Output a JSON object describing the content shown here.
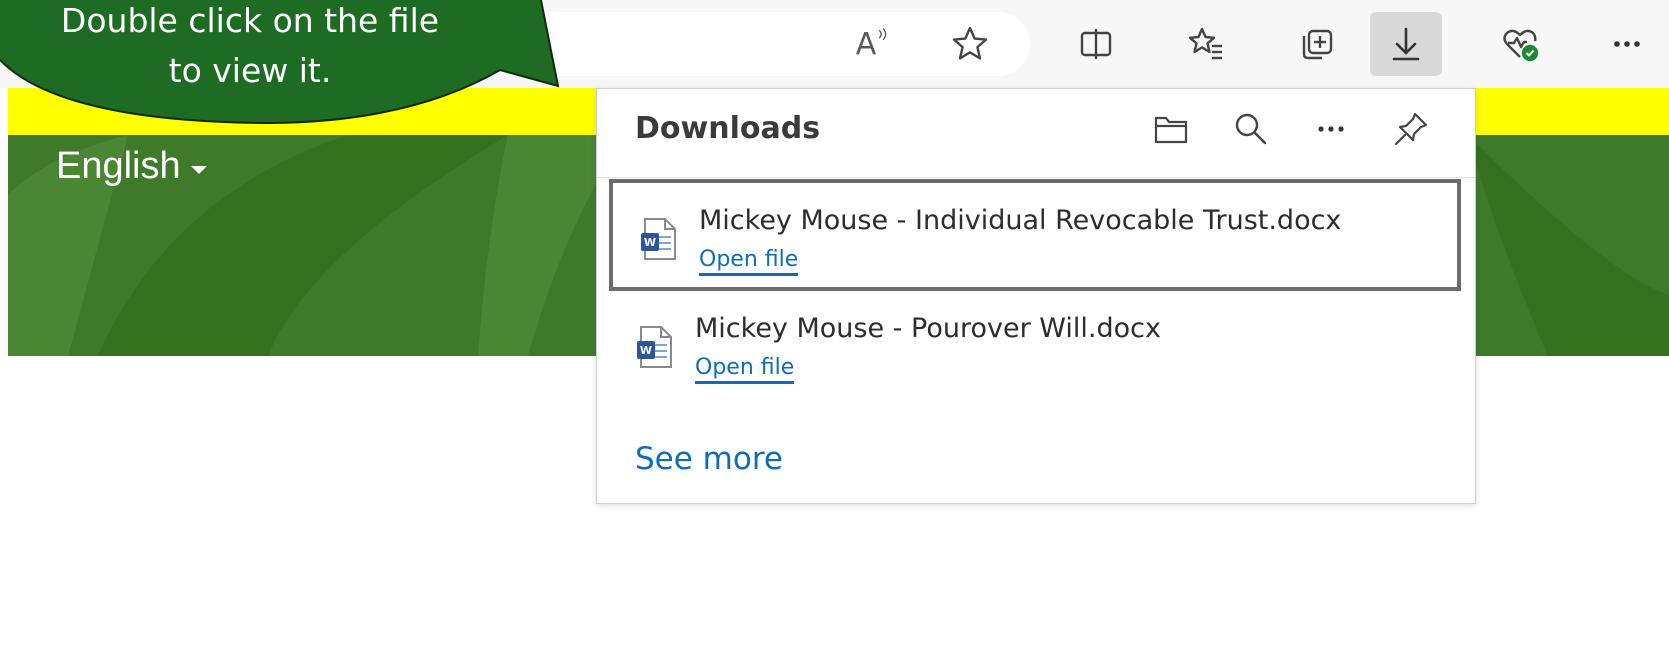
{
  "callout": {
    "line1": "Double click on the file",
    "line2": "to view it."
  },
  "toolbar": {
    "read_aloud_label": "A",
    "buttons": [
      "read-aloud-icon",
      "favorite-star-icon",
      "split-screen-icon",
      "favorites-icon",
      "collections-icon",
      "downloads-icon",
      "browser-essentials-icon",
      "more-menu-icon"
    ]
  },
  "page": {
    "language": "English"
  },
  "downloads": {
    "title": "Downloads",
    "items": [
      {
        "name": "Mickey Mouse - Individual Revocable Trust.docx",
        "action": "Open file"
      },
      {
        "name": "Mickey Mouse - Pourover Will.docx",
        "action": "Open file"
      }
    ],
    "see_more": "See more"
  },
  "colors": {
    "green_band": "#3f7a2a",
    "yellow_band": "#ffff00",
    "callout_fill": "#1e6b24",
    "link": "#0f6cbd"
  }
}
